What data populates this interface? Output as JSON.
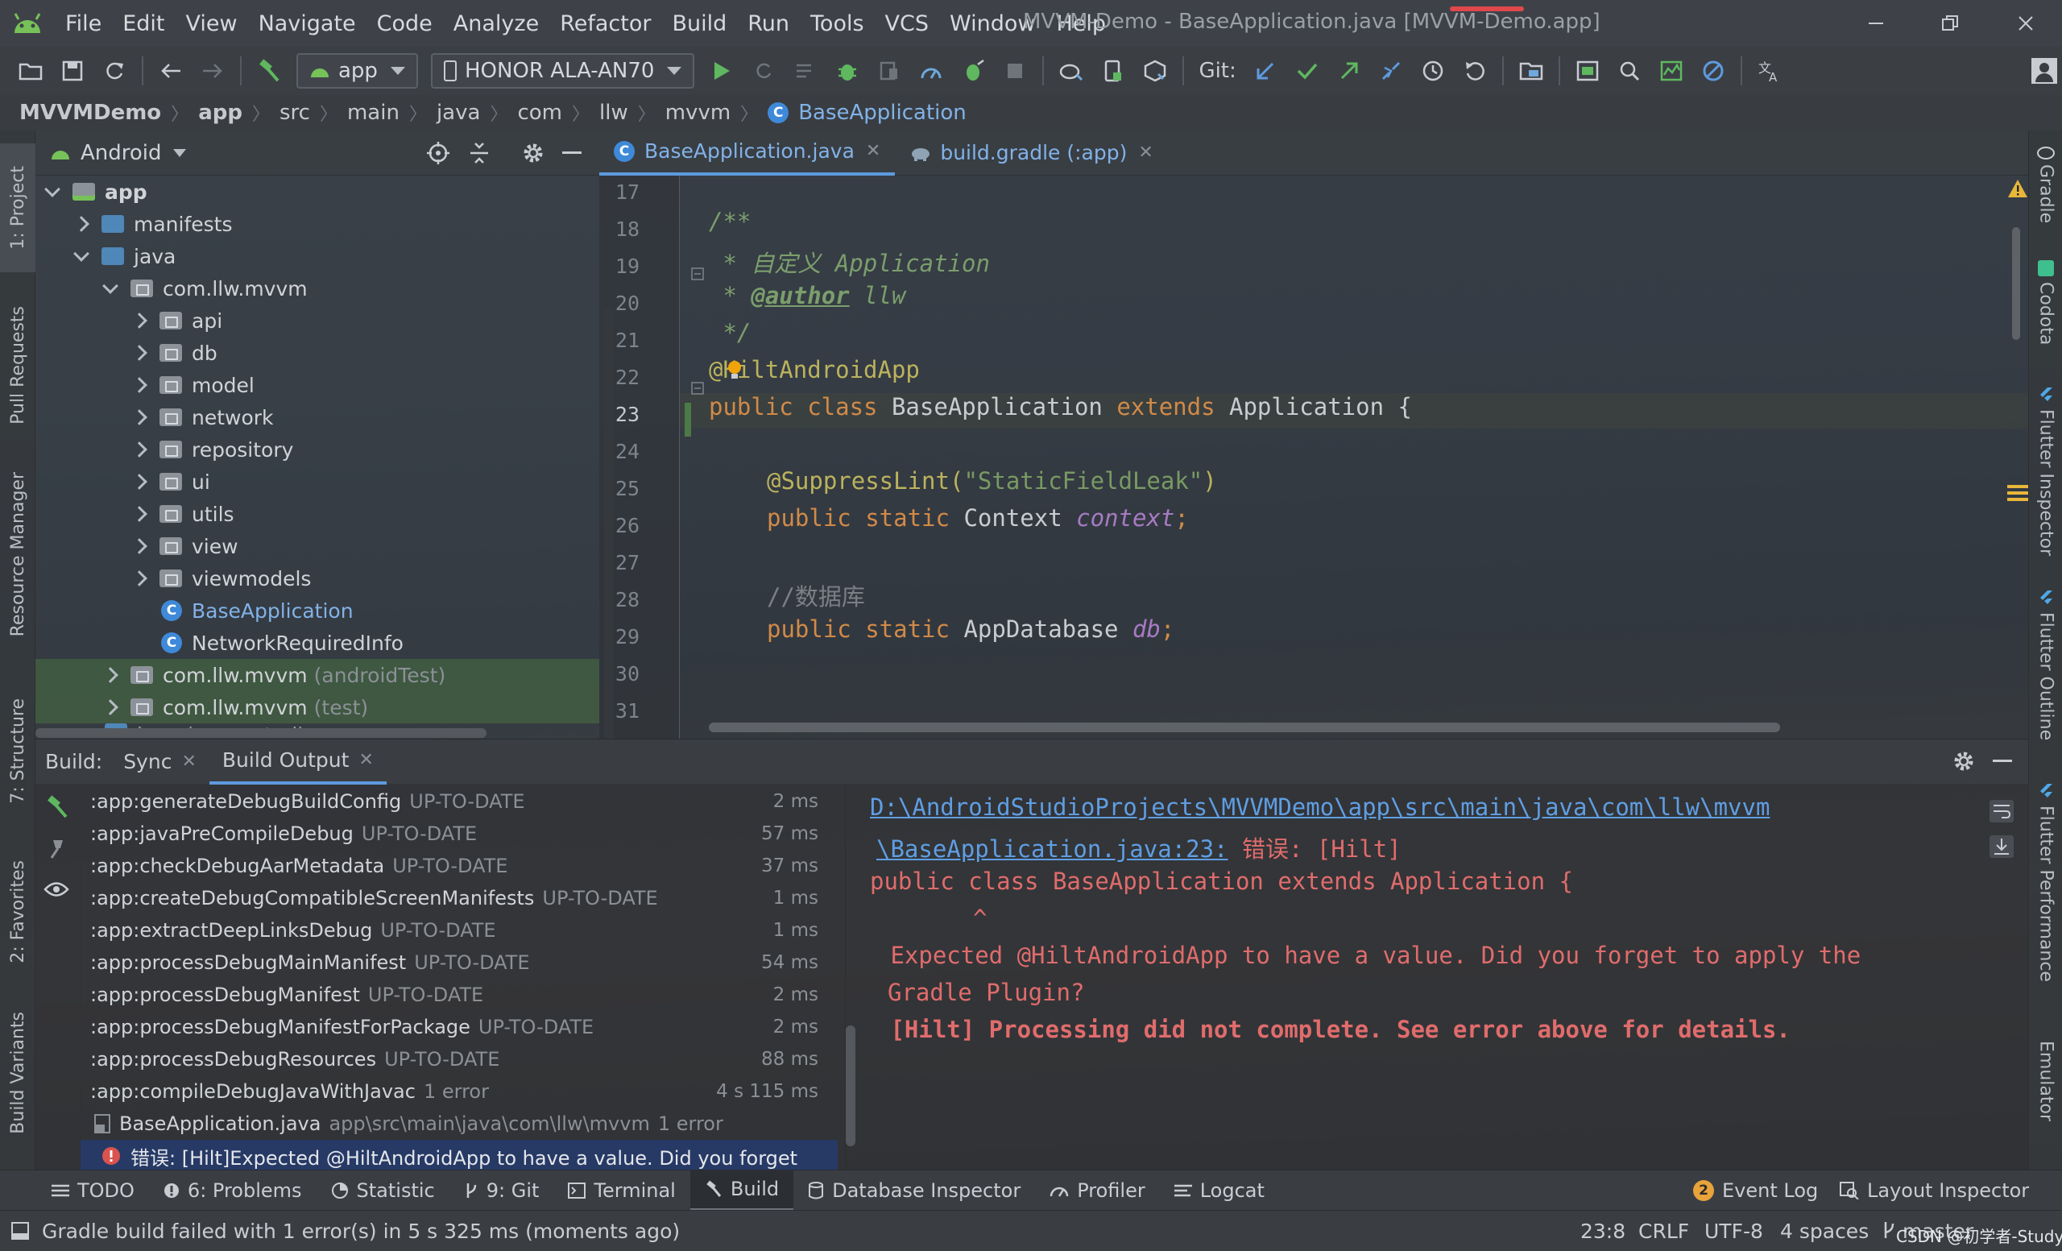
{
  "app": {
    "title": "MVVM-Demo - BaseApplication.java [MVVM-Demo.app]",
    "menu": [
      "File",
      "Edit",
      "View",
      "Navigate",
      "Code",
      "Analyze",
      "Refactor",
      "Build",
      "Run",
      "Tools",
      "VCS",
      "Window",
      "Help"
    ]
  },
  "toolbar": {
    "run_config": "app",
    "device": "HONOR ALA-AN70",
    "git_label": "Git:"
  },
  "breadcrumb": [
    "MVVMDemo",
    "app",
    "src",
    "main",
    "java",
    "com",
    "llw",
    "mvvm",
    "BaseApplication"
  ],
  "left_tool_tabs": [
    "1: Project",
    "Pull Requests",
    "Resource Manager",
    "7: Structure",
    "2: Favorites",
    "Build Variants"
  ],
  "right_tool_tabs": [
    "Gradle",
    "Codota",
    "Flutter Inspector",
    "Flutter Outline",
    "Flutter Performance",
    "Emulator"
  ],
  "project": {
    "view": "Android",
    "tree": [
      {
        "label": "app",
        "suffix": ""
      },
      {
        "label": "manifests",
        "suffix": ""
      },
      {
        "label": "java",
        "suffix": ""
      },
      {
        "label": "com.llw.mvvm",
        "suffix": ""
      },
      {
        "label": "api",
        "suffix": ""
      },
      {
        "label": "db",
        "suffix": ""
      },
      {
        "label": "model",
        "suffix": ""
      },
      {
        "label": "network",
        "suffix": ""
      },
      {
        "label": "repository",
        "suffix": ""
      },
      {
        "label": "ui",
        "suffix": ""
      },
      {
        "label": "utils",
        "suffix": ""
      },
      {
        "label": "view",
        "suffix": ""
      },
      {
        "label": "viewmodels",
        "suffix": ""
      },
      {
        "label": "BaseApplication",
        "suffix": ""
      },
      {
        "label": "NetworkRequiredInfo",
        "suffix": ""
      },
      {
        "label": "com.llw.mvvm",
        "suffix": "(androidTest)"
      },
      {
        "label": "com.llw.mvvm",
        "suffix": "(test)"
      },
      {
        "label": "java (generated)",
        "suffix": ""
      }
    ]
  },
  "editor": {
    "tabs": [
      {
        "label": "BaseApplication.java",
        "active": true
      },
      {
        "label": "build.gradle (:app)",
        "active": false
      }
    ],
    "line_numbers": [
      "17",
      "18",
      "19",
      "20",
      "21",
      "22",
      "23",
      "24",
      "25",
      "26",
      "27",
      "28",
      "29",
      "30",
      "31"
    ],
    "current_line": "23",
    "code": {
      "l18": "/**",
      "l19_prefix": " * ",
      "l19_text": "自定义 Application",
      "l20_prefix": " * ",
      "l20_tag": "@author",
      "l20_text": " llw",
      "l21": " */",
      "l22": "@HiltAndroidApp",
      "l23_kw1": "public class",
      "l23_name": " BaseApplication ",
      "l23_kw2": "extends",
      "l23_rest": " Application {",
      "l25_ann": "@SuppressLint(",
      "l25_str": "\"StaticFieldLeak\"",
      "l25_end": ")",
      "l26_kw": "public static",
      "l26_type": " Context ",
      "l26_field": "context",
      "l26_end": ";",
      "l28": "//数据库",
      "l29_kw": "public static",
      "l29_type": " AppDatabase ",
      "l29_field": "db",
      "l29_end": ";"
    }
  },
  "build": {
    "label": "Build:",
    "tabs": [
      "Sync",
      "Build Output"
    ],
    "tasks": [
      {
        "name": ":app:generateDebugBuildConfig",
        "status": "UP-TO-DATE",
        "time": "2 ms"
      },
      {
        "name": ":app:javaPreCompileDebug",
        "status": "UP-TO-DATE",
        "time": "57 ms"
      },
      {
        "name": ":app:checkDebugAarMetadata",
        "status": "UP-TO-DATE",
        "time": "37 ms"
      },
      {
        "name": ":app:createDebugCompatibleScreenManifests",
        "status": "UP-TO-DATE",
        "time": "1 ms"
      },
      {
        "name": ":app:extractDeepLinksDebug",
        "status": "UP-TO-DATE",
        "time": "1 ms"
      },
      {
        "name": ":app:processDebugMainManifest",
        "status": "UP-TO-DATE",
        "time": "54 ms"
      },
      {
        "name": ":app:processDebugManifest",
        "status": "UP-TO-DATE",
        "time": "2 ms"
      },
      {
        "name": ":app:processDebugManifestForPackage",
        "status": "UP-TO-DATE",
        "time": "2 ms"
      },
      {
        "name": ":app:processDebugResources",
        "status": "UP-TO-DATE",
        "time": "88 ms"
      },
      {
        "name": ":app:compileDebugJavaWithJavac",
        "status": "1 error",
        "time": "4 s 115 ms"
      }
    ],
    "file_row": {
      "name": "BaseApplication.java",
      "path": "app\\src\\main\\java\\com\\llw\\mvvm",
      "count": "1 error"
    },
    "error_row": "错误: [Hilt]Expected @HiltAndroidApp to have a value. Did you forget",
    "console": {
      "path1": "D:\\AndroidStudioProjects\\MVVMDemo\\app\\src\\main\\java\\com\\llw\\mvvm",
      "path2": "\\BaseApplication.java:23:",
      "error_tag": " 错误: [Hilt]",
      "line3": "public class BaseApplication extends Application {",
      "caret": "^",
      "line5": " Expected @HiltAndroidApp to have a value. Did you forget to apply the",
      "line6": "Gradle Plugin?",
      "line7": " [Hilt] Processing did not complete. See error above for details."
    }
  },
  "bottom_tabs": [
    "TODO",
    "6: Problems",
    "Statistic",
    "9: Git",
    "Terminal",
    "Build",
    "Database Inspector",
    "Profiler",
    "Logcat"
  ],
  "bottom_right_tabs": {
    "event_log_count": "2",
    "event_log": "Event Log",
    "layout_inspector": "Layout Inspector"
  },
  "status": {
    "message": "Gradle build failed with 1 error(s) in 5 s 325 ms (moments ago)",
    "position": "23:8",
    "line_sep": "CRLF",
    "encoding": "UTF-8",
    "indent": "4 spaces",
    "branch": "master",
    "watermark": "CSDN @初学者-Study"
  },
  "colors": {
    "accent": "#5e9ade",
    "error": "#e06c6c",
    "keyword": "#d18a48",
    "android_green": "#77c159"
  }
}
